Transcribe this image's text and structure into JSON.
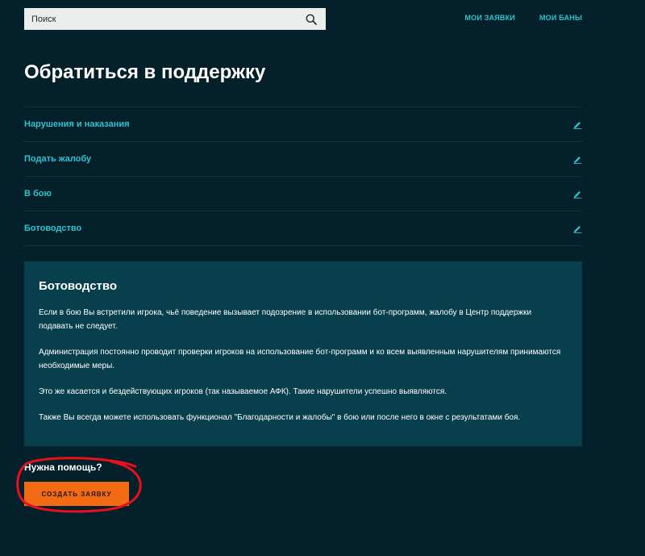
{
  "header": {
    "search": {
      "placeholder": "Поиск",
      "value": ""
    },
    "nav": [
      {
        "label": "Мои заявки"
      },
      {
        "label": "Мои баны"
      }
    ]
  },
  "main": {
    "title": "Обратиться в поддержку",
    "faq_items": [
      {
        "label": "Нарушения и наказания",
        "icon": "pencil-icon"
      },
      {
        "label": "Подать жалобу",
        "icon": "pencil-icon"
      },
      {
        "label": "В бою",
        "icon": "pencil-icon"
      },
      {
        "label": "Ботоводство",
        "icon": "pencil-icon"
      }
    ],
    "panel": {
      "title": "Ботоводство",
      "paragraphs": [
        "Если в бою Вы встретили игрока, чьё поведение вызывает подозрение в использовании бот-программ, жалобу в Центр поддержки подавать не следует.",
        "Администрация постоянно проводит проверки игроков на использование бот-программ и ко всем выявленным нарушителям принимаются необходимые меры.",
        "Это же касается и бездействующих игроков (так называемое АФК). Такие нарушители успешно выявляются.",
        "Также Вы всегда можете использовать функционал \"Благодарности и жалобы\" в бою или после него в окне с результатами боя."
      ]
    },
    "help": {
      "label": "Нужна помощь?",
      "button_label": "Создать заявку"
    }
  },
  "colors": {
    "background": "#03202b",
    "accent": "#2ec3cf",
    "panel": "#073f4d",
    "button": "#f26a13",
    "annotation": "#e8101c"
  }
}
